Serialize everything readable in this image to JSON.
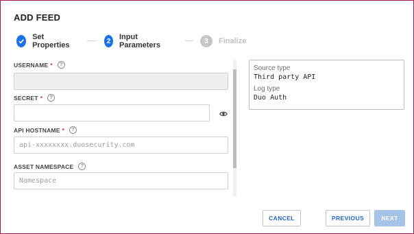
{
  "dialog": {
    "title": "ADD FEED"
  },
  "stepper": {
    "steps": [
      {
        "number": "✓",
        "label": "Set Properties",
        "state": "done"
      },
      {
        "number": "2",
        "label": "Input Parameters",
        "state": "active"
      },
      {
        "number": "3",
        "label": "Finalize",
        "state": "pending"
      }
    ]
  },
  "form": {
    "username": {
      "label": "USERNAME",
      "required": "*",
      "value": ""
    },
    "secret": {
      "label": "SECRET",
      "required": "*",
      "value": ""
    },
    "api_hostname": {
      "label": "API HOSTNAME",
      "required": "*",
      "placeholder": "api-xxxxxxxx.duosecurity.com"
    },
    "asset_namespace": {
      "label": "ASSET NAMESPACE",
      "placeholder": "Namespace"
    },
    "help_glyph": "?"
  },
  "info": {
    "source_type_label": "Source type",
    "source_type_value": "Third party API",
    "log_type_label": "Log type",
    "log_type_value": "Duo Auth"
  },
  "actions": {
    "cancel": "CANCEL",
    "previous": "PREVIOUS",
    "next": "NEXT"
  },
  "colors": {
    "accent": "#1a73e8",
    "required": "#d32f2f",
    "frame_border": "#9b1b52"
  },
  "icons": {
    "check": "check-icon",
    "help": "help-circle-icon",
    "show_secret": "eye-icon"
  }
}
